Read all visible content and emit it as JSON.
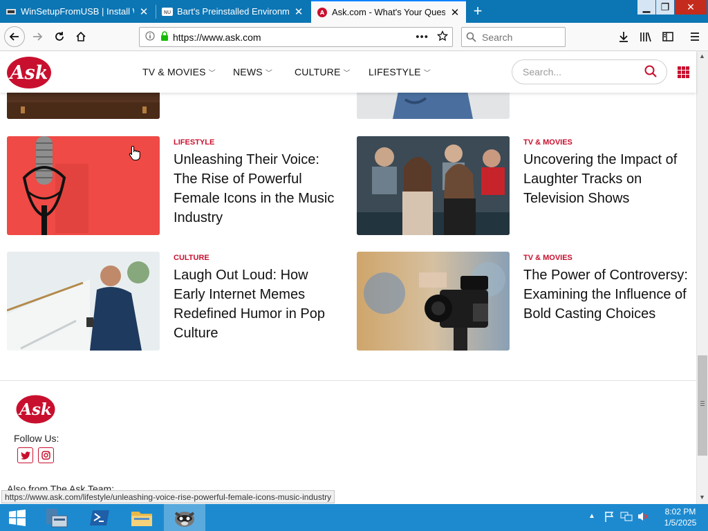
{
  "browser": {
    "tabs": [
      {
        "title": "WinSetupFromUSB | Install Win",
        "active": false
      },
      {
        "title": "Bart's Preinstalled Environment",
        "active": false
      },
      {
        "title": "Ask.com - What's Your Questio",
        "active": true
      }
    ],
    "new_tab_symbol": "+",
    "url": "https://www.ask.com",
    "search_placeholder": "Search",
    "status_link": "https://www.ask.com/lifestyle/unleashing-voice-rise-powerful-female-icons-music-industry"
  },
  "site": {
    "logo_text": "Ask",
    "nav": [
      {
        "label": "TV & MOVIES"
      },
      {
        "label": "NEWS"
      },
      {
        "label": "CULTURE"
      },
      {
        "label": "LIFESTYLE"
      }
    ],
    "search_placeholder": "Search...",
    "articles": [
      {
        "category": "LIFESTYLE",
        "title": "Unleashing Their Voice: The Rise of Powerful Female Icons in the Music Industry",
        "image": "microphone"
      },
      {
        "category": "TV & MOVIES",
        "title": "Uncovering the Impact of Laughter Tracks on Television Shows",
        "image": "laughing audience"
      },
      {
        "category": "CULTURE",
        "title": "Laugh Out Loud: How Early Internet Memes Redefined Humor in Pop Culture",
        "image": "man with phone"
      },
      {
        "category": "TV & MOVIES",
        "title": "The Power of Controversy: Examining the Influence of Bold Casting Choices",
        "image": "video camera"
      }
    ],
    "footer": {
      "follow_label": "Follow Us:",
      "also_from": "Also from The Ask Team:"
    },
    "brand_color": "#c8102e"
  },
  "taskbar": {
    "time": "8:02 PM",
    "date": "1/5/2025"
  }
}
